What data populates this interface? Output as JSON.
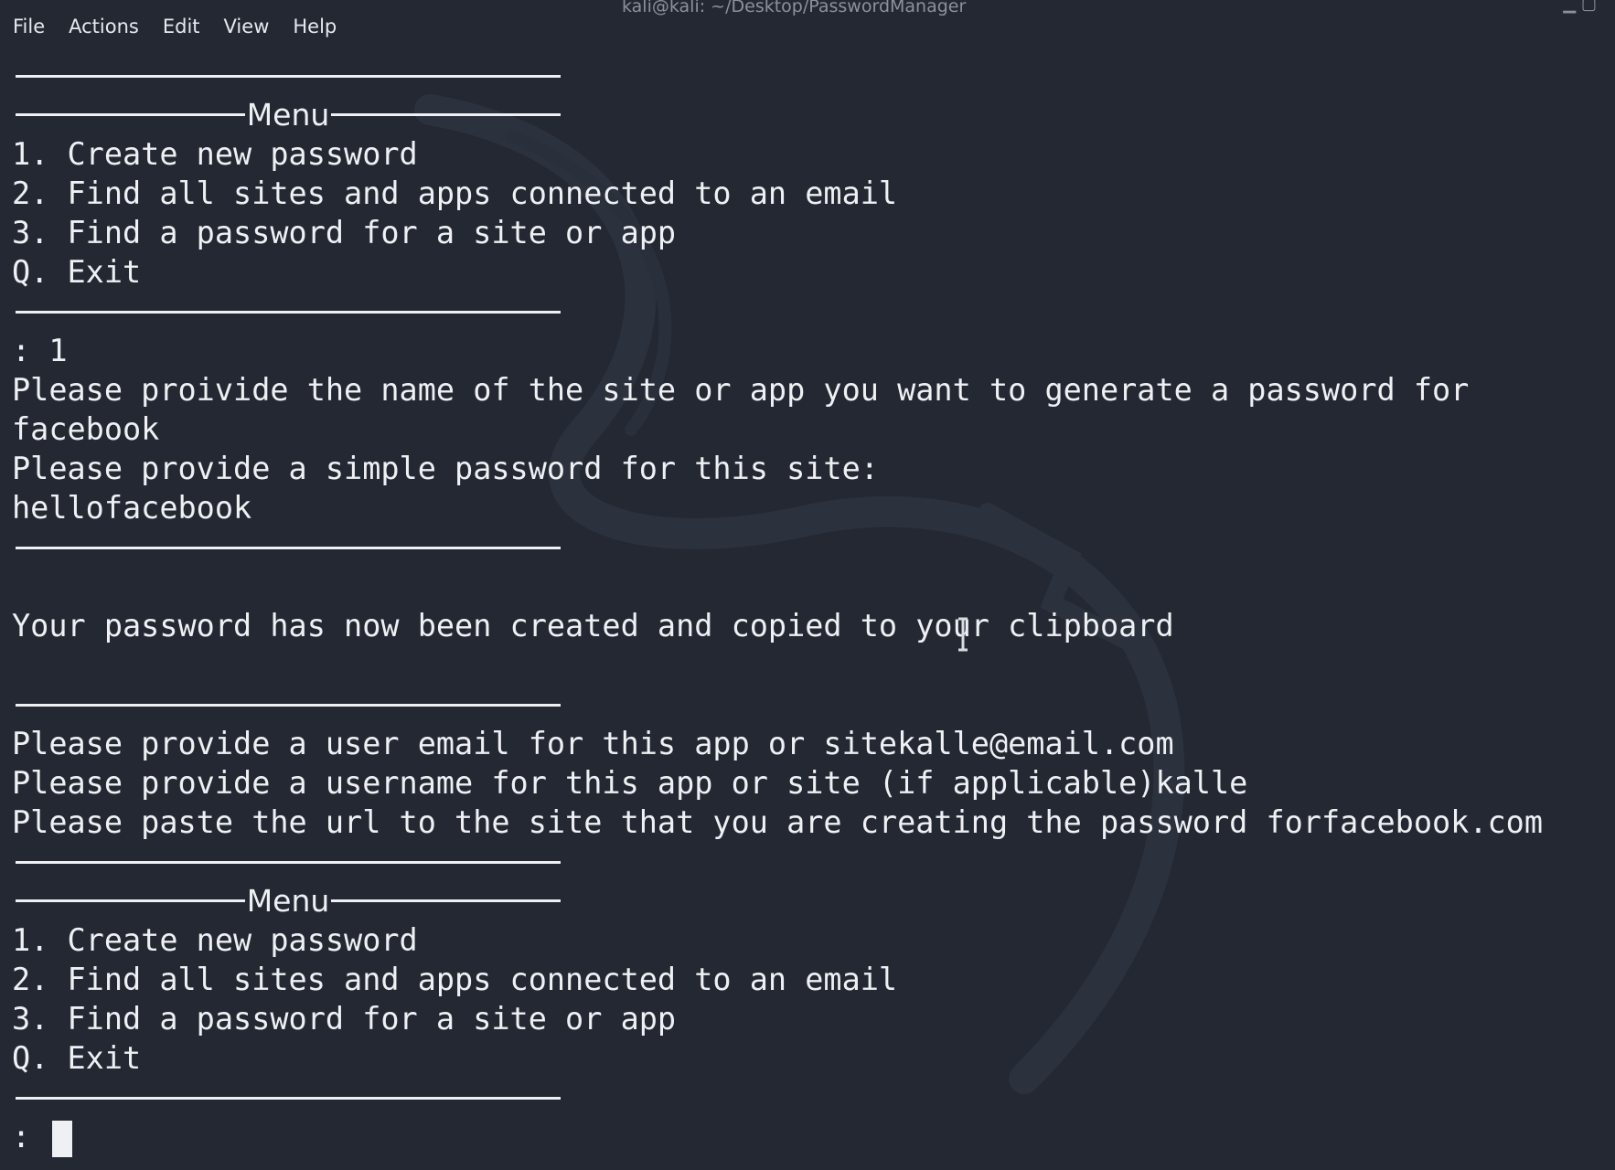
{
  "menubar": {
    "items": [
      "File",
      "Actions",
      "Edit",
      "View",
      "Help"
    ]
  },
  "window": {
    "title": "kali@kali: ~/Desktop/PasswordManager"
  },
  "terminal": {
    "menu_title": "Menu",
    "menu_options": [
      "1. Create new password",
      "2. Find all sites and apps connected to an email",
      "3. Find a password for a site or app",
      "Q. Exit"
    ],
    "input_1": ": 1",
    "site_prompt": "Please proivide the name of the site or app you want to generate a password for",
    "site_answer": "facebook",
    "simple_pw_prompt": "Please provide a simple password for this site:",
    "simple_pw_answer": "hellofacebook",
    "created_msg": "Your password has now been created and copied to your clipboard",
    "email_line": "Please provide a user email for this app or sitekalle@email.com",
    "username_line": "Please provide a username for this app or site (if applicable)kalle",
    "url_line": "Please paste the url to the site that you are creating the password forfacebook.com",
    "prompt": ": "
  },
  "colors": {
    "background": "#232833",
    "text": "#eef0f3"
  }
}
